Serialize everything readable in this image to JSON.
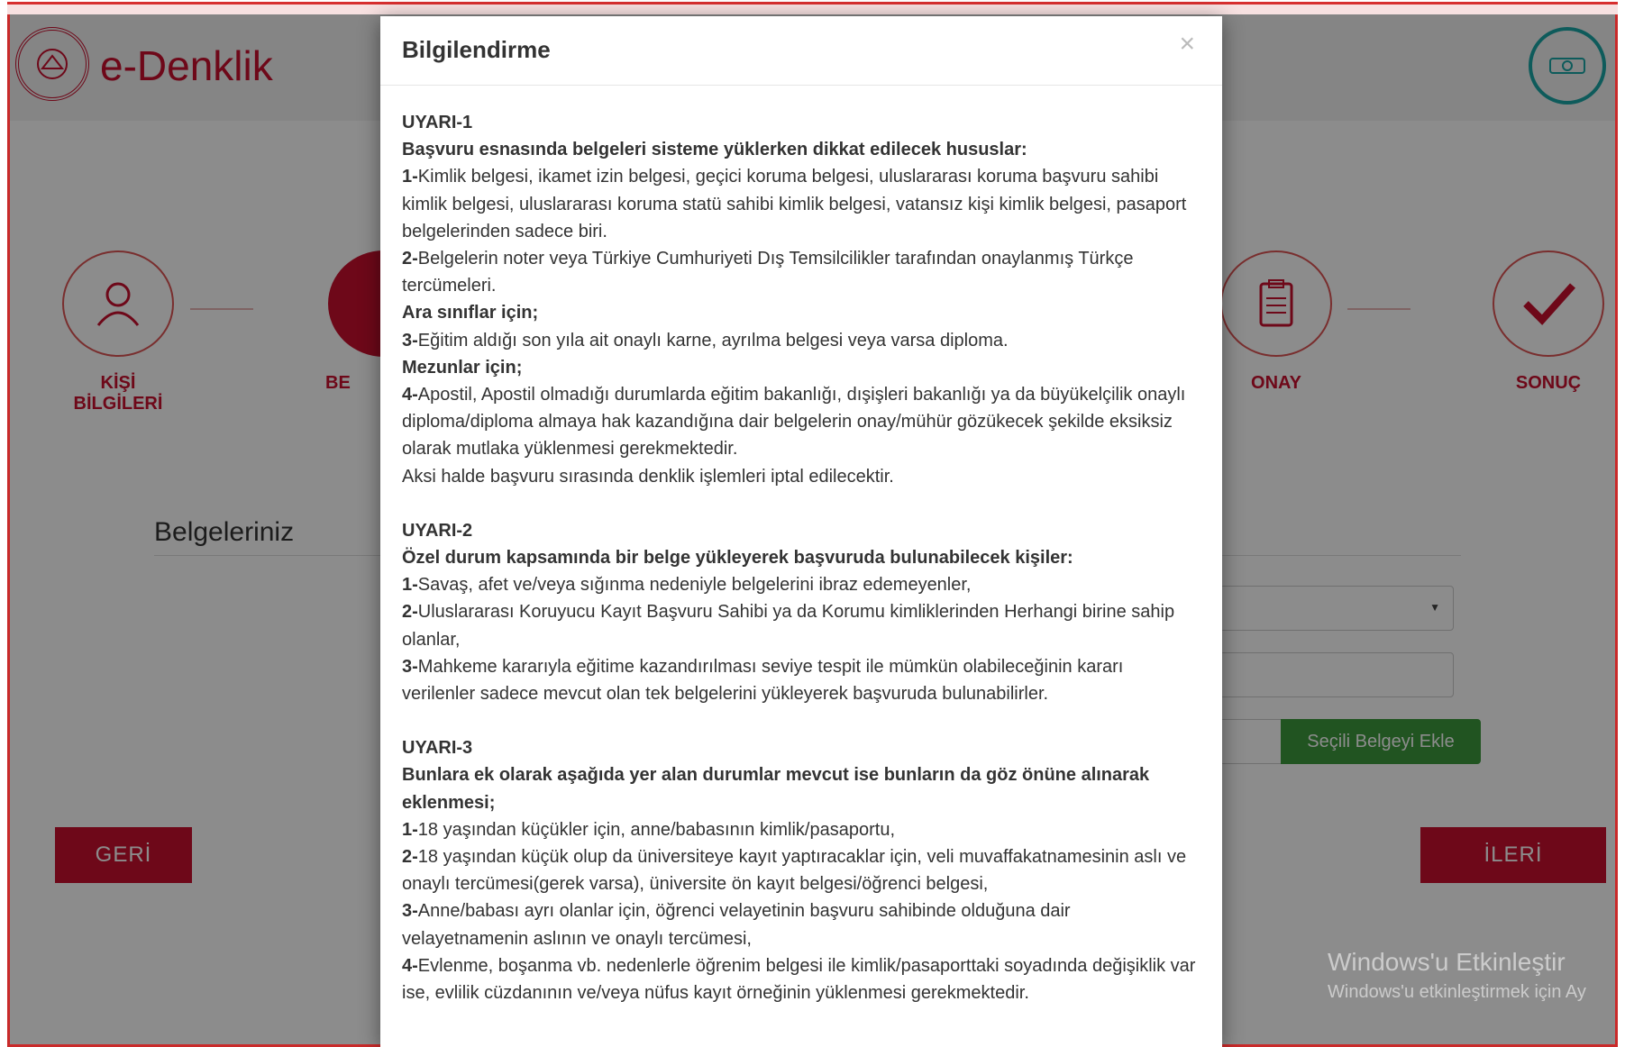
{
  "app": {
    "brand": "e-Denklik"
  },
  "steps": [
    {
      "label1": "KİŞİ",
      "label2": "BİLGİLERİ"
    },
    {
      "label1": "BE",
      "label2": ""
    },
    {
      "label1": "ONAY",
      "label2": ""
    },
    {
      "label1": "SONUÇ",
      "label2": ""
    }
  ],
  "form": {
    "section_title": "Belgeleriniz",
    "add_button": "Seçili Belgeyi Ekle"
  },
  "nav": {
    "back": "GERİ",
    "next": "İLERİ"
  },
  "watermark": {
    "line1": "Windows'u Etkinleştir",
    "line2": "Windows'u etkinleştirmek için Ay"
  },
  "modal": {
    "title": "Bilgilendirme",
    "close": "×",
    "w1": {
      "heading": "UYARI-1",
      "subtitle": "Başvuru esnasında belgeleri sisteme yüklerken dikkat edilecek hususlar:",
      "i1n": "1-",
      "i1": "Kimlik belgesi, ikamet izin belgesi, geçici koruma belgesi, uluslararası koruma başvuru sahibi kimlik belgesi, uluslararası koruma statü sahibi kimlik belgesi, vatansız kişi kimlik belgesi, pasaport belgelerinden sadece biri.",
      "i2n": "2-",
      "i2": "Belgelerin noter veya Türkiye Cumhuriyeti Dış Temsilcilikler tarafından onaylanmış Türkçe tercümeleri.",
      "sub2": "Ara sınıflar için;",
      "i3n": "3-",
      "i3": "Eğitim aldığı son yıla ait onaylı karne, ayrılma belgesi veya varsa diploma.",
      "sub3": "Mezunlar için;",
      "i4n": "4-",
      "i4": "Apostil, Apostil olmadığı durumlarda eğitim bakanlığı, dışişleri bakanlığı ya da büyükelçilik onaylı diploma/diploma almaya hak kazandığına dair belgelerin onay/mühür gözükecek şekilde eksiksiz olarak mutlaka yüklenmesi gerekmektedir.",
      "note": "Aksi halde başvuru sırasında denklik işlemleri iptal edilecektir."
    },
    "w2": {
      "heading": "UYARI-2",
      "subtitle": "Özel durum kapsamında bir belge yükleyerek başvuruda bulunabilecek kişiler:",
      "i1n": "1-",
      "i1": "Savaş, afet ve/veya sığınma nedeniyle belgelerini ibraz edemeyenler,",
      "i2n": "2-",
      "i2": "Uluslararası Koruyucu Kayıt Başvuru Sahibi ya da Korumu kimliklerinden Herhangi birine sahip olanlar,",
      "i3n": "3-",
      "i3": "Mahkeme kararıyla eğitime kazandırılması seviye tespit ile mümkün olabileceğinin kararı verilenler sadece mevcut olan tek belgelerini yükleyerek başvuruda bulunabilirler."
    },
    "w3": {
      "heading": "UYARI-3",
      "subtitle": "Bunlara ek olarak aşağıda yer alan durumlar mevcut ise bunların da göz önüne alınarak eklenmesi;",
      "i1n": "1-",
      "i1": "18 yaşından küçükler için, anne/babasının kimlik/pasaportu,",
      "i2n": "2-",
      "i2": "18 yaşından küçük olup da üniversiteye kayıt yaptıracaklar için, veli muvaffakatnamesinin aslı ve onaylı tercümesi(gerek varsa), üniversite ön kayıt belgesi/öğrenci belgesi,",
      "i3n": "3-",
      "i3": "Anne/babası ayrı olanlar için, öğrenci velayetinin başvuru sahibinde olduğuna dair velayetnamenin aslının ve onaylı tercümesi,",
      "i4n": "4-",
      "i4": "Evlenme, boşanma vb. nedenlerle öğrenim belgesi ile kimlik/pasaporttaki soyadında değişiklik var ise, evlilik cüzdanının ve/veya nüfus kayıt örneğinin yüklenmesi gerekmektedir."
    }
  }
}
